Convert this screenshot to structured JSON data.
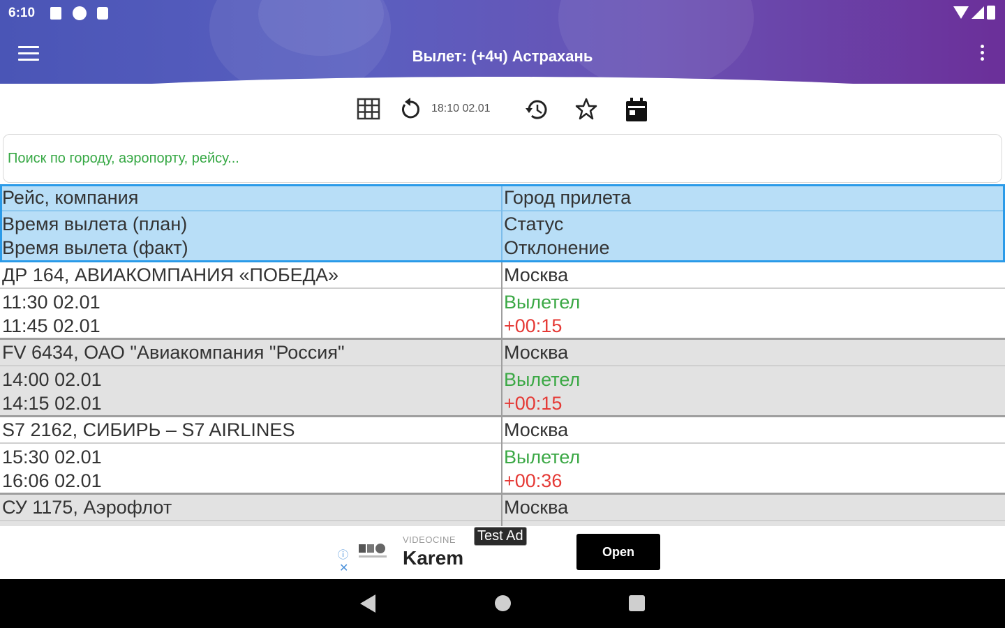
{
  "status_bar": {
    "time": "6:10",
    "icons": [
      "notification-a-icon",
      "notification-p-icon",
      "sd-card-icon",
      "wifi-icon",
      "signal-icon",
      "battery-icon"
    ]
  },
  "app_bar": {
    "title": "Вылет: (+4ч) Астрахань",
    "menu_icon": "hamburger-menu-icon",
    "overflow_icon": "more-vertical-icon"
  },
  "toolbar": {
    "last_updated": "18:10 02.01",
    "icons": [
      "grid-icon",
      "refresh-icon",
      "history-icon",
      "star-icon",
      "calendar-icon"
    ]
  },
  "search": {
    "placeholder": "Поиск по городу, аэропорту, рейсу..."
  },
  "table": {
    "header": {
      "col1": [
        "Рейс, компания",
        "Время вылета (план)",
        "Время вылета (факт)"
      ],
      "col2": [
        "Город прилета",
        "Статус",
        "Отклонение"
      ]
    },
    "rows": [
      {
        "flight": "ДР 164, АВИАКОМПАНИЯ «ПОБЕДА»",
        "planned": "11:30 02.01",
        "actual": "11:45 02.01",
        "city": "Москва",
        "status": "Вылетел",
        "delay": "+00:15"
      },
      {
        "flight": "FV 6434, ОАО \"Авиакомпания \"Россия\"",
        "planned": "14:00 02.01",
        "actual": "14:15 02.01",
        "city": "Москва",
        "status": "Вылетел",
        "delay": "+00:15"
      },
      {
        "flight": "S7 2162, СИБИРЬ – S7 AIRLINES",
        "planned": "15:30 02.01",
        "actual": "16:06 02.01",
        "city": "Москва",
        "status": "Вылетел",
        "delay": "+00:36"
      },
      {
        "flight": "СУ 1175, Аэрофлот",
        "planned": "",
        "actual": "",
        "city": "Москва",
        "status": "",
        "delay": ""
      }
    ]
  },
  "ad": {
    "advertiser": "VIDEOCINE",
    "title": "Karem",
    "badge": "Test Ad",
    "button": "Open",
    "info_icon": "ⓘ",
    "close_icon": "✕"
  },
  "colors": {
    "header_bg": "#b8def7",
    "header_border": "#2a9ae8",
    "status_ok": "#3ba845",
    "delay": "#e53935",
    "placeholder": "#36a844"
  }
}
